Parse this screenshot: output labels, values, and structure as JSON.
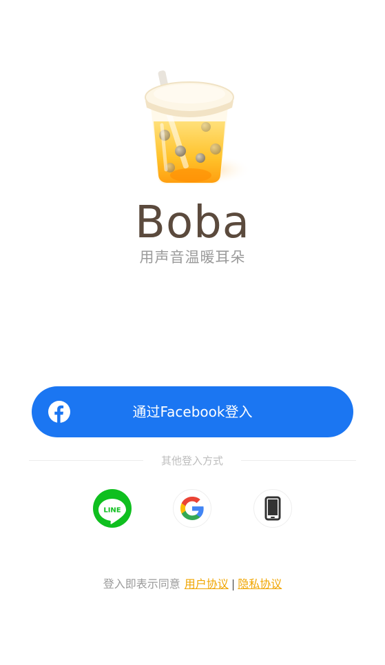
{
  "app": {
    "name": "Boba",
    "tagline": "用声音温暖耳朵"
  },
  "facebook_login": {
    "label": "通过Facebook登入",
    "color": "#1b76f2"
  },
  "other_login": {
    "label": "其他登入方式",
    "options": [
      {
        "icon": "line-icon",
        "text": "LINE",
        "color": "#0fbf1f"
      },
      {
        "icon": "google-icon"
      },
      {
        "icon": "phone-icon"
      }
    ]
  },
  "agreement": {
    "prefix": "登入即表示同意",
    "user_agreement": "用户协议",
    "separator": "|",
    "privacy_agreement": "隐私协议",
    "link_color": "#f0a500"
  }
}
